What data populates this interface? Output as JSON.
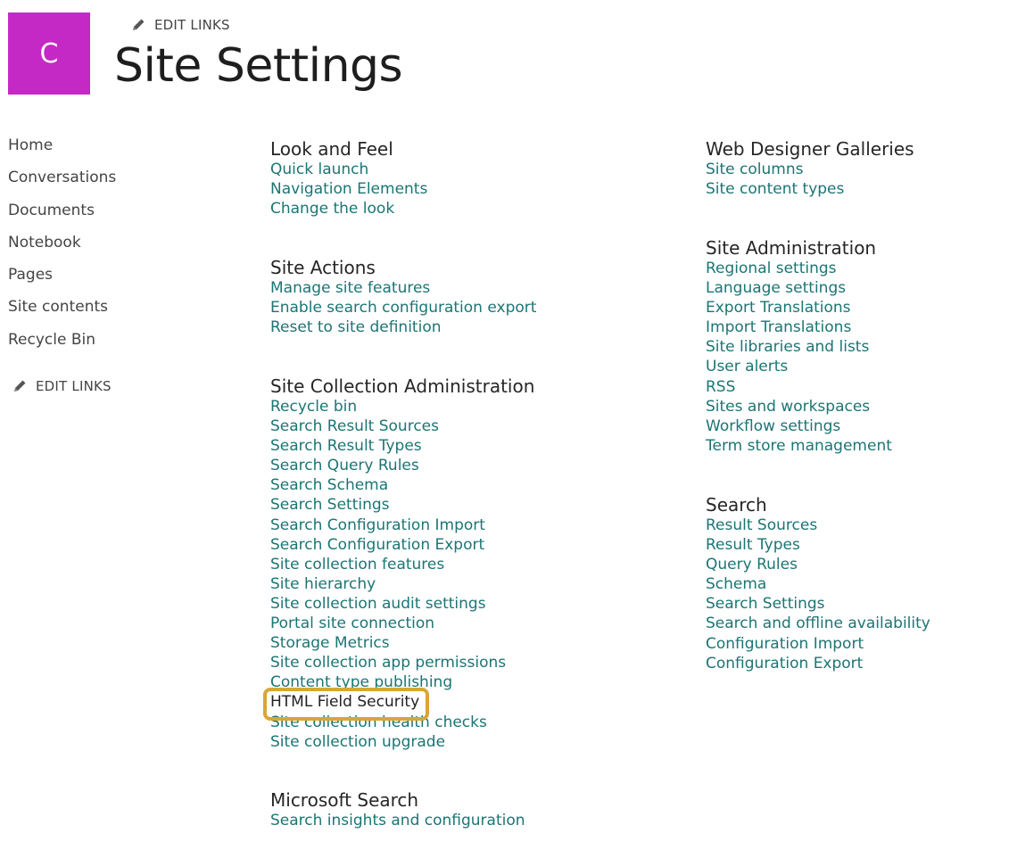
{
  "header": {
    "logo_letter": "C",
    "logo_color": "#c529c5",
    "edit_links_label": "EDIT LINKS",
    "title": "Site Settings"
  },
  "left_nav": {
    "items": [
      "Home",
      "Conversations",
      "Documents",
      "Notebook",
      "Pages",
      "Site contents",
      "Recycle Bin"
    ],
    "edit_links_label": "EDIT LINKS"
  },
  "colors": {
    "link": "#1c7574",
    "highlight_border": "#d9a636"
  },
  "middle_column": [
    {
      "title": "Look and Feel",
      "links": [
        "Quick launch",
        "Navigation Elements",
        "Change the look"
      ]
    },
    {
      "title": "Site Actions",
      "links": [
        "Manage site features",
        "Enable search configuration export",
        "Reset to site definition"
      ]
    },
    {
      "title": "Site Collection Administration",
      "links": [
        "Recycle bin",
        "Search Result Sources",
        "Search Result Types",
        "Search Query Rules",
        "Search Schema",
        "Search Settings",
        "Search Configuration Import",
        "Search Configuration Export",
        "Site collection features",
        "Site hierarchy",
        "Site collection audit settings",
        "Portal site connection",
        "Storage Metrics",
        "Site collection app permissions",
        "Content type publishing",
        "HTML Field Security",
        "Site collection health checks",
        "Site collection upgrade"
      ],
      "highlighted_link": "HTML Field Security"
    },
    {
      "title": "Microsoft Search",
      "links": [
        "Search insights and configuration"
      ]
    }
  ],
  "right_column": [
    {
      "title": "Web Designer Galleries",
      "links": [
        "Site columns",
        "Site content types"
      ]
    },
    {
      "title": "Site Administration",
      "links": [
        "Regional settings",
        "Language settings",
        "Export Translations",
        "Import Translations",
        "Site libraries and lists",
        "User alerts",
        "RSS",
        "Sites and workspaces",
        "Workflow settings",
        "Term store management"
      ]
    },
    {
      "title": "Search",
      "links": [
        "Result Sources",
        "Result Types",
        "Query Rules",
        "Schema",
        "Search Settings",
        "Search and offline availability",
        "Configuration Import",
        "Configuration Export"
      ]
    }
  ]
}
